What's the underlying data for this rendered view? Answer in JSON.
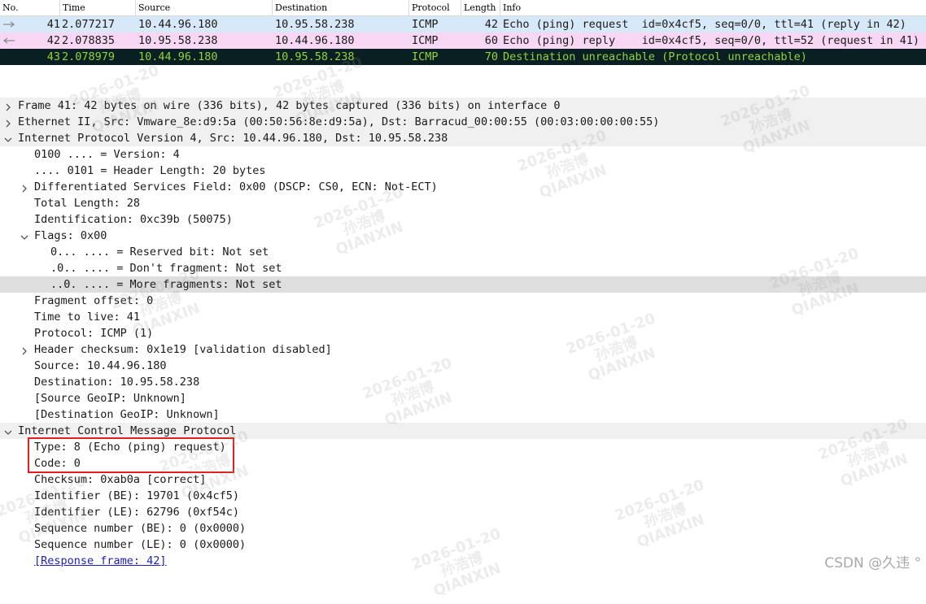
{
  "colors": {
    "row_request": "#d7e8f8",
    "row_reply": "#f8d7f4",
    "row_selected": "#0a1f22",
    "row_selected_text": "#93d33c",
    "highlight_box": "#e02020"
  },
  "packet_list": {
    "columns": [
      "No.",
      "Time",
      "Source",
      "Destination",
      "Protocol",
      "Length",
      "Info"
    ],
    "rows": [
      {
        "no": "41",
        "time": "2.077217",
        "source": "10.44.96.180",
        "destination": "10.95.58.238",
        "protocol": "ICMP",
        "length": "42",
        "info": "Echo (ping) request  id=0x4cf5, seq=0/0, ttl=41 (reply in 42)",
        "direction_icon": "arrow-right-icon"
      },
      {
        "no": "42",
        "time": "2.078835",
        "source": "10.95.58.238",
        "destination": "10.44.96.180",
        "protocol": "ICMP",
        "length": "60",
        "info": "Echo (ping) reply    id=0x4cf5, seq=0/0, ttl=52 (request in 41)",
        "direction_icon": "arrow-left-icon"
      },
      {
        "no": "43",
        "time": "2.078979",
        "source": "10.44.96.180",
        "destination": "10.95.58.238",
        "protocol": "ICMP",
        "length": "70",
        "info": "Destination unreachable (Protocol unreachable)",
        "direction_icon": ""
      }
    ]
  },
  "detail_tree": [
    {
      "text": "Frame 41: 42 bytes on wire (336 bits), 42 bytes captured (336 bits) on interface 0",
      "toggle": "collapsed"
    },
    {
      "text": "Ethernet II, Src: Vmware_8e:d9:5a (00:50:56:8e:d9:5a), Dst: Barracud_00:00:55 (00:03:00:00:00:55)",
      "toggle": "collapsed"
    },
    {
      "text": "Internet Protocol Version 4, Src: 10.44.96.180, Dst: 10.95.58.238",
      "toggle": "expanded"
    },
    {
      "text": "0100 .... = Version: 4"
    },
    {
      "text": ".... 0101 = Header Length: 20 bytes"
    },
    {
      "text": "Differentiated Services Field: 0x00 (DSCP: CS0, ECN: Not-ECT)",
      "toggle": "collapsed"
    },
    {
      "text": "Total Length: 28"
    },
    {
      "text": "Identification: 0xc39b (50075)"
    },
    {
      "text": "Flags: 0x00",
      "toggle": "expanded"
    },
    {
      "text": "0... .... = Reserved bit: Not set"
    },
    {
      "text": ".0.. .... = Don't fragment: Not set"
    },
    {
      "text": "..0. .... = More fragments: Not set"
    },
    {
      "text": "Fragment offset: 0"
    },
    {
      "text": "Time to live: 41"
    },
    {
      "text": "Protocol: ICMP (1)"
    },
    {
      "text": "Header checksum: 0x1e19 [validation disabled]",
      "toggle": "collapsed"
    },
    {
      "text": "Source: 10.44.96.180"
    },
    {
      "text": "Destination: 10.95.58.238"
    },
    {
      "text": "[Source GeoIP: Unknown]"
    },
    {
      "text": "[Destination GeoIP: Unknown]"
    },
    {
      "text": "Internet Control Message Protocol",
      "toggle": "expanded"
    },
    {
      "text": "Type: 8 (Echo (ping) request)"
    },
    {
      "text": "Code: 0"
    },
    {
      "text": "Checksum: 0xab0a [correct]"
    },
    {
      "text": "Identifier (BE): 19701 (0x4cf5)"
    },
    {
      "text": "Identifier (LE): 62796 (0xf54c)"
    },
    {
      "text": "Sequence number (BE): 0 (0x0000)"
    },
    {
      "text": "Sequence number (LE): 0 (0x0000)"
    },
    {
      "text": "[Response frame: 42]",
      "link": true
    }
  ],
  "watermark": {
    "date": "2026-01-20",
    "name": "孙浩博",
    "org": "QIANXIN"
  },
  "footer": {
    "csdn_label": "CSDN @久违 °"
  }
}
